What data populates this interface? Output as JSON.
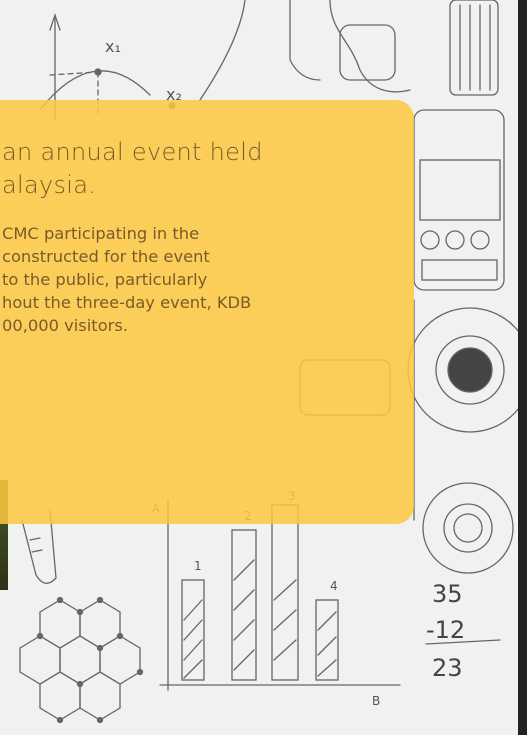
{
  "card": {
    "title_lines": [
      "an annual event held",
      "alaysia."
    ],
    "body_lines": [
      "CMC participating in the",
      "constructed for the event",
      "to the public, particularly",
      "hout the three-day event, KDB",
      "00,000 visitors."
    ]
  },
  "sketch_labels": {
    "x1": "x₁",
    "x2": "x₂",
    "bar1": "1",
    "bar2": "2",
    "bar3": "3",
    "bar4": "4",
    "axis_b": "B",
    "axis_a": "A",
    "sum_top": "35",
    "sum_mid": "-12",
    "sum_result": "23"
  },
  "colors": {
    "card": "#fcc840",
    "card_text": "#7a5a2a",
    "board": "#f1f1ef"
  }
}
